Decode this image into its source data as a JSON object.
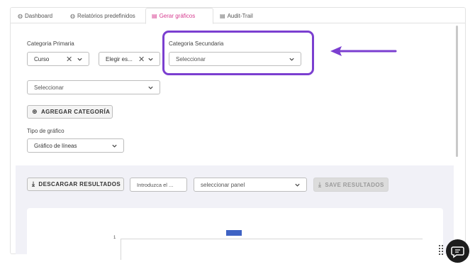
{
  "tabs": [
    {
      "label": "Dashboard",
      "icon": "gauge-icon",
      "active": false
    },
    {
      "label": "Relatórios predefinidos",
      "icon": "gauge-icon",
      "active": false
    },
    {
      "label": "Gerar gráficos",
      "icon": "document-icon",
      "active": true
    },
    {
      "label": "Audit-Trail",
      "icon": "document-icon",
      "active": false
    }
  ],
  "primary": {
    "label": "Categoria Primaria",
    "value": "Curso",
    "second_value": "Elegir es..."
  },
  "secondary": {
    "label": "Categoria Secundaria",
    "placeholder": "Seleccionar"
  },
  "third_select": {
    "placeholder": "Seleccionar"
  },
  "add_category_label": "AGREGAR CATEGORÍA",
  "chart_type": {
    "label": "Tipo de gráfico",
    "value": "Gráfico de líneas"
  },
  "results": {
    "download_label": "DESCARGAR RESULTADOS",
    "name_input_placeholder": "Introduzca el ...",
    "panel_select_placeholder": "seleccionar panel",
    "save_label": "SAVE RESULTADOS"
  },
  "chart": {
    "tick_label": "1"
  },
  "colors": {
    "accent": "#d63b8f",
    "highlight": "#7b3fd0",
    "bar": "#3f63c4"
  }
}
